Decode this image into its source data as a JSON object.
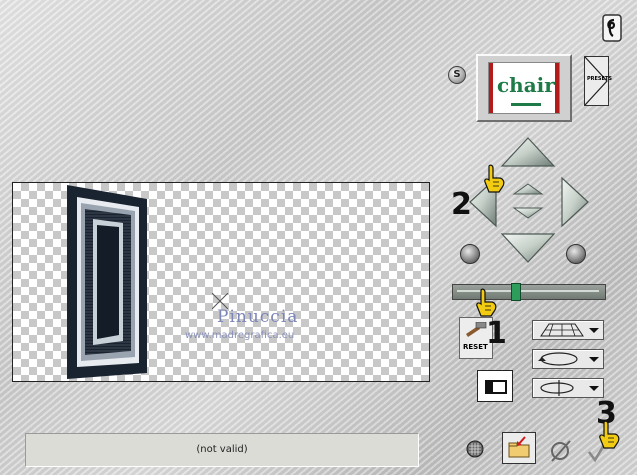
{
  "app": {
    "preset_label": "PRESETS",
    "s_button_label": "S",
    "thumbnail_word": "chair",
    "reset_label": "RESET",
    "status_text": "(not valid)",
    "watermark_line1": "Pinuccia",
    "watermark_line2": "www.madregrafica.eu"
  },
  "annotations": {
    "step1": "1",
    "step2": "2",
    "step3": "3"
  },
  "icons": [
    "help-icon",
    "arrow-up-icon",
    "arrow-down-icon",
    "arrow-left-icon",
    "arrow-right-icon",
    "reset-icon",
    "perspective-icon",
    "rotate-icon",
    "flip-icon",
    "grid-icon",
    "folder-icon",
    "cancel-icon",
    "ok-icon",
    "pointer-hand-icon"
  ],
  "colors": {
    "frame_dark": "#1a2330",
    "frame_light": "#e8ecf0",
    "accent_green": "#2c9d5a",
    "hand_yellow": "#f2cc12"
  }
}
